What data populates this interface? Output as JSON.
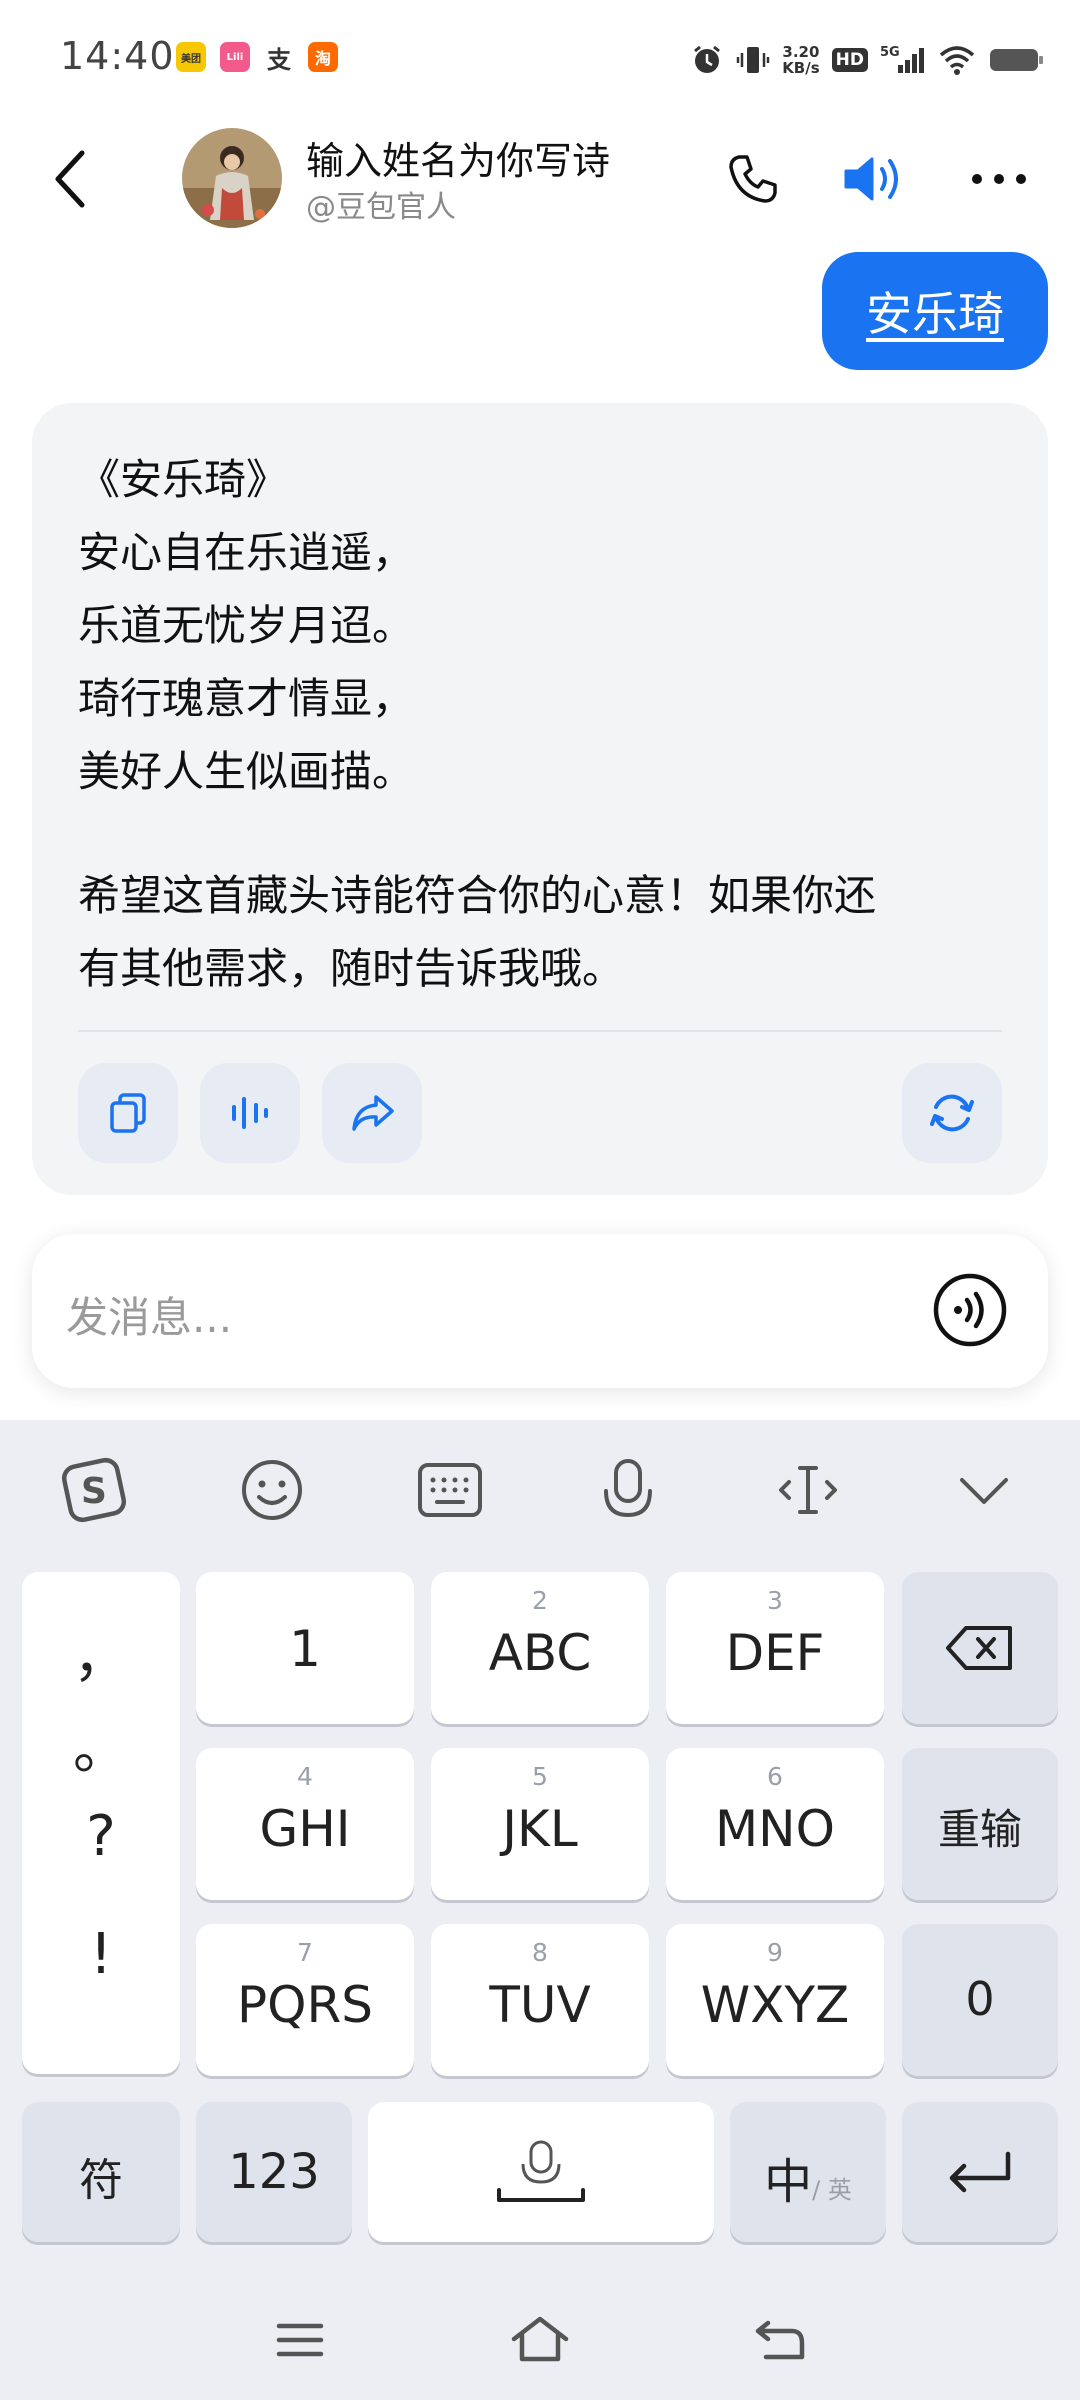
{
  "status_bar": {
    "time": "14:40",
    "apps": [
      "美团",
      "Lili",
      "支",
      "淘"
    ],
    "net_speed_value": "3.20",
    "net_speed_unit": "KB/s",
    "hd_label": "HD",
    "network": "5G"
  },
  "header": {
    "bot_name": "输入姓名为你写诗",
    "bot_handle": "@豆包官人"
  },
  "chat": {
    "user_message": "安乐琦",
    "poem_lines": [
      "《安乐琦》",
      "安心自在乐逍遥，",
      "乐道无忧岁月迢。",
      "琦行瑰意才情显，",
      "美好人生似画描。"
    ],
    "closing_lines": [
      "希望这首藏头诗能符合你的心意！如果你还",
      "有其他需求，随时告诉我哦。"
    ]
  },
  "input": {
    "placeholder": "发消息..."
  },
  "keyboard": {
    "punctuation": [
      "，",
      "。",
      "?",
      "!"
    ],
    "rows": [
      [
        {
          "num": "",
          "label": "1"
        },
        {
          "num": "2",
          "label": "ABC"
        },
        {
          "num": "3",
          "label": "DEF"
        }
      ],
      [
        {
          "num": "4",
          "label": "GHI"
        },
        {
          "num": "5",
          "label": "JKL"
        },
        {
          "num": "6",
          "label": "MNO"
        }
      ],
      [
        {
          "num": "7",
          "label": "PQRS"
        },
        {
          "num": "8",
          "label": "TUV"
        },
        {
          "num": "9",
          "label": "WXYZ"
        }
      ]
    ],
    "retype": "重输",
    "zero": "0",
    "symbols": "符",
    "numbers": "123",
    "lang_primary": "中",
    "lang_secondary": "/ 英"
  },
  "colors": {
    "accent": "#1a73f0",
    "card_bg": "#f3f4f6",
    "keyboard_bg": "#eceef3"
  }
}
